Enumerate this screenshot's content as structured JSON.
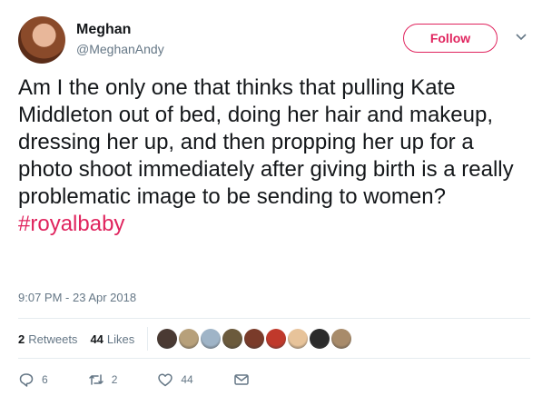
{
  "user": {
    "name": "Meghan",
    "handle": "@MeghanAndy"
  },
  "follow_label": "Follow",
  "tweet": {
    "text": "Am I the only one that thinks that pulling Kate Middleton out of bed, doing her hair and makeup, dressing her up, and then propping her up for a photo shoot immediately after giving birth is a really problematic image to be sending to women?",
    "hashtag": "#royalbaby",
    "timestamp": "9:07 PM - 23 Apr 2018"
  },
  "stats": {
    "retweets_count": "2",
    "retweets_label": "Retweets",
    "likes_count": "44",
    "likes_label": "Likes",
    "liker_colors": [
      "#4a3a33",
      "#b7a07a",
      "#9fb4c7",
      "#6b5a3c",
      "#7a3b2a",
      "#c0392b",
      "#e7c39a",
      "#2b2b2b",
      "#a88b6a"
    ]
  },
  "actions": {
    "reply_count": "6",
    "retweet_count": "2",
    "like_count": "44",
    "icons": [
      "reply-icon",
      "retweet-icon",
      "like-icon",
      "message-icon"
    ]
  },
  "colors": {
    "accent": "#e0245e",
    "muted": "#657786"
  }
}
